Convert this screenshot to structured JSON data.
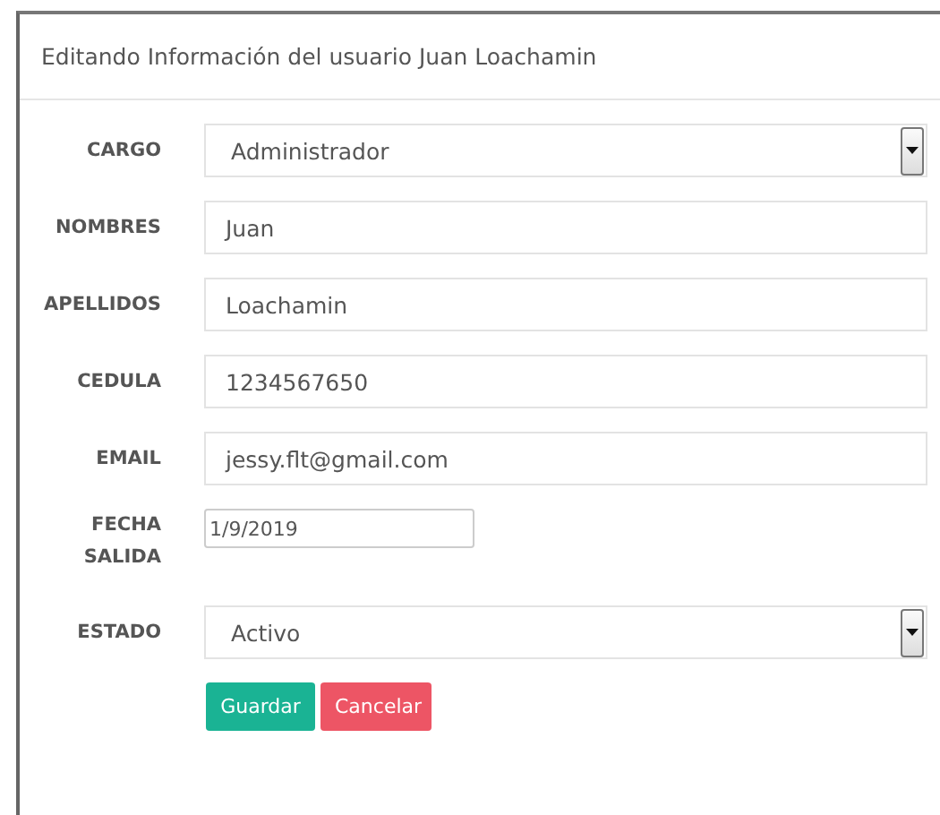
{
  "dialog": {
    "title": "Editando Información del usuario Juan Loachamin"
  },
  "fields": [
    {
      "kind": "select",
      "label": "CARGO",
      "value": "Administrador"
    },
    {
      "kind": "text",
      "label": "NOMBRES",
      "value": "Juan"
    },
    {
      "kind": "text",
      "label": "APELLIDOS",
      "value": "Loachamin"
    },
    {
      "kind": "text",
      "label": "CEDULA",
      "value": "1234567650"
    },
    {
      "kind": "text",
      "label": "EMAIL",
      "value": "jessy.flt@gmail.com"
    },
    {
      "kind": "date",
      "label": "FECHA SALIDA",
      "value": "1/9/2019"
    },
    {
      "kind": "select",
      "label": "ESTADO",
      "value": "Activo"
    }
  ],
  "buttons": [
    {
      "kind": "primary",
      "label": "Guardar"
    },
    {
      "kind": "danger",
      "label": "Cancelar"
    }
  ]
}
